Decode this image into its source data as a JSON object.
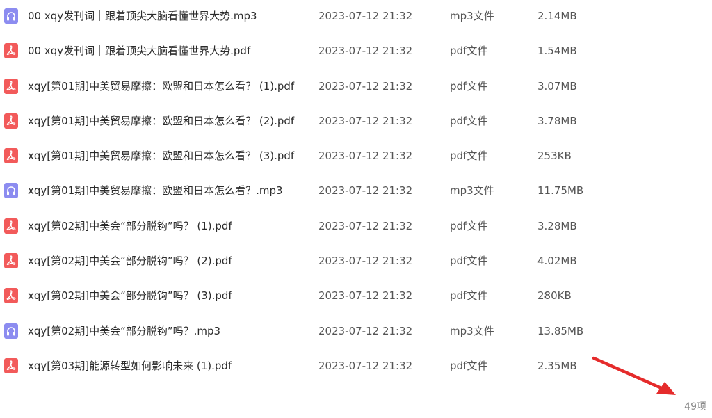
{
  "colors": {
    "pdf_icon": "#f25a5a",
    "mp3_icon": "#8c8cf0",
    "annotation_arrow": "#e52b2b"
  },
  "files": [
    {
      "name": "00 xqy发刊词｜跟着顶尖大脑看懂世界大势.mp3",
      "date": "2023-07-12 21:32",
      "type": "mp3文件",
      "size": "2.14MB",
      "icon": "headphones-icon"
    },
    {
      "name": "00 xqy发刊词｜跟着顶尖大脑看懂世界大势.pdf",
      "date": "2023-07-12 21:32",
      "type": "pdf文件",
      "size": "1.54MB",
      "icon": "pdf-icon"
    },
    {
      "name": "xqy[第01期]中美贸易摩擦：欧盟和日本怎么看？ (1).pdf",
      "date": "2023-07-12 21:32",
      "type": "pdf文件",
      "size": "3.07MB",
      "icon": "pdf-icon"
    },
    {
      "name": "xqy[第01期]中美贸易摩擦：欧盟和日本怎么看？ (2).pdf",
      "date": "2023-07-12 21:32",
      "type": "pdf文件",
      "size": "3.78MB",
      "icon": "pdf-icon"
    },
    {
      "name": "xqy[第01期]中美贸易摩擦：欧盟和日本怎么看？ (3).pdf",
      "date": "2023-07-12 21:32",
      "type": "pdf文件",
      "size": "253KB",
      "icon": "pdf-icon"
    },
    {
      "name": "xqy[第01期]中美贸易摩擦：欧盟和日本怎么看？.mp3",
      "date": "2023-07-12 21:32",
      "type": "mp3文件",
      "size": "11.75MB",
      "icon": "headphones-icon"
    },
    {
      "name": "xqy[第02期]中美会“部分脱钩”吗？ (1).pdf",
      "date": "2023-07-12 21:32",
      "type": "pdf文件",
      "size": "3.28MB",
      "icon": "pdf-icon"
    },
    {
      "name": "xqy[第02期]中美会“部分脱钩”吗？ (2).pdf",
      "date": "2023-07-12 21:32",
      "type": "pdf文件",
      "size": "4.02MB",
      "icon": "pdf-icon"
    },
    {
      "name": "xqy[第02期]中美会“部分脱钩”吗？ (3).pdf",
      "date": "2023-07-12 21:32",
      "type": "pdf文件",
      "size": "280KB",
      "icon": "pdf-icon"
    },
    {
      "name": "xqy[第02期]中美会“部分脱钩”吗？.mp3",
      "date": "2023-07-12 21:32",
      "type": "mp3文件",
      "size": "13.85MB",
      "icon": "headphones-icon"
    },
    {
      "name": "xqy[第03期]能源转型如何影响未来 (1).pdf",
      "date": "2023-07-12 21:32",
      "type": "pdf文件",
      "size": "2.35MB",
      "icon": "pdf-icon"
    }
  ],
  "footer": {
    "item_count": "49项"
  }
}
